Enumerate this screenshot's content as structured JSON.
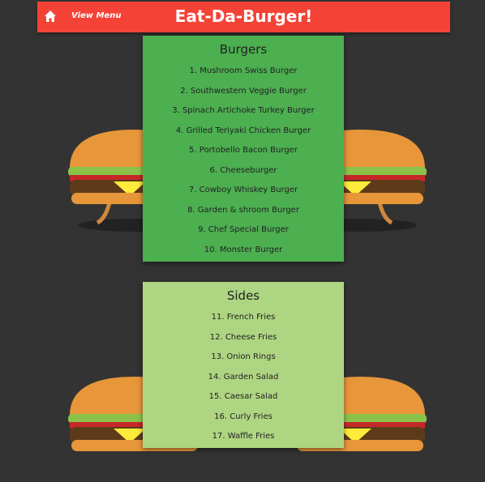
{
  "header": {
    "title": "Eat-Da-Burger!",
    "view_menu_label": "View Menu"
  },
  "burgers": {
    "title": "Burgers",
    "items": [
      "1. Mushroom Swiss Burger",
      "2. Southwestern Veggie Burger",
      "3. Spinach Artichoke Turkey Burger",
      "4. Grilled Teriyaki Chicken Burger",
      "5. Portobello Bacon Burger",
      "6. Cheeseburger",
      "7. Cowboy Whiskey Burger",
      "8. Garden & shroom Burger",
      "9. Chef Special Burger",
      "10. Monster Burger"
    ]
  },
  "sides": {
    "title": "Sides",
    "items": [
      "11. French Fries",
      "12. Cheese Fries",
      "13. Onion Rings",
      "14. Garden Salad",
      "15. Caesar Salad",
      "16. Curly Fries",
      "17. Waffle Fries"
    ]
  },
  "colors": {
    "background": "#333333",
    "header": "#f44336",
    "burgers_card": "#4caf50",
    "sides_card": "#aed581"
  },
  "icons": {
    "home": "home-icon",
    "background_art": "burger-mascot-illustration"
  }
}
